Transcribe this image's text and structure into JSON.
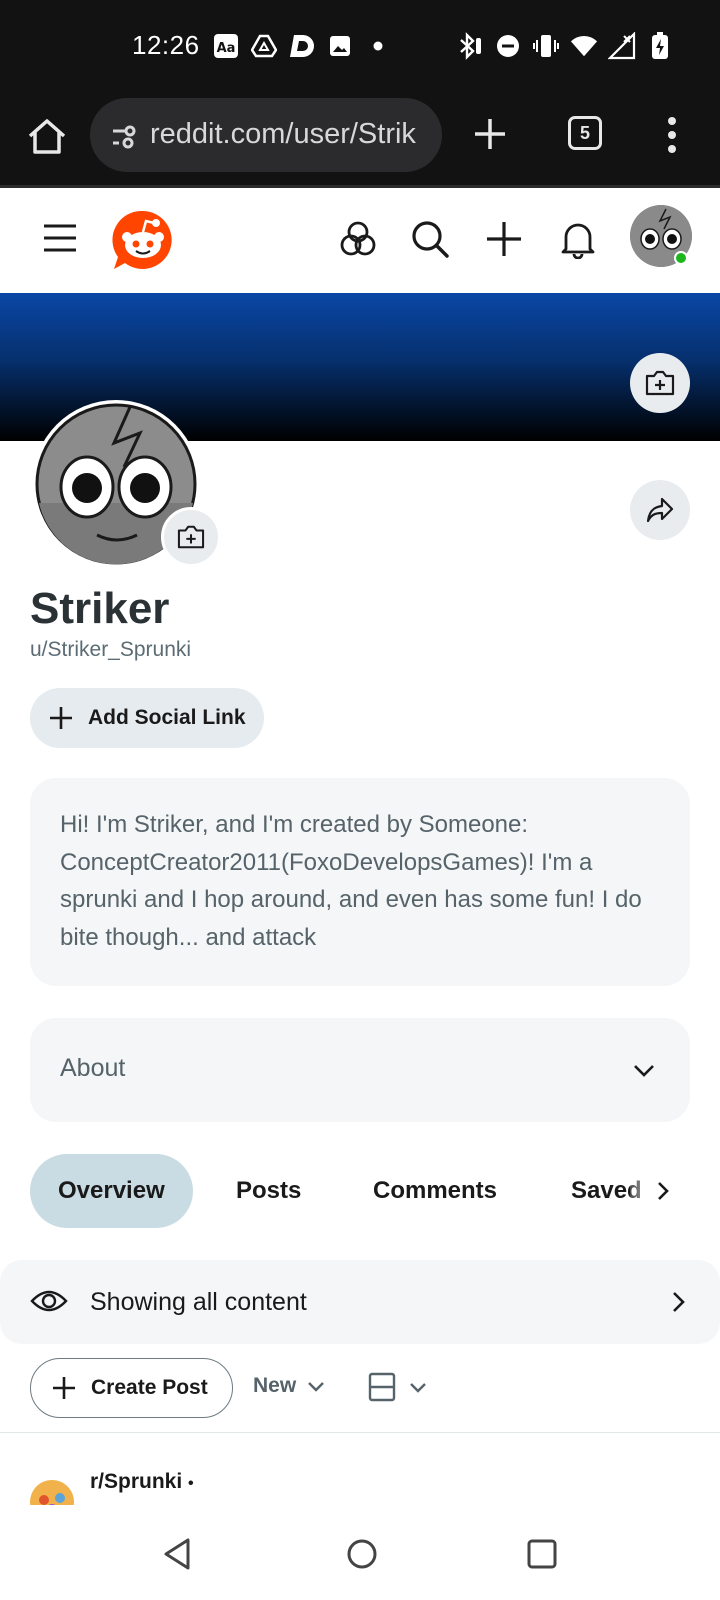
{
  "status_bar": {
    "time": "12:26",
    "left_icons": [
      "translate-icon",
      "drive-icon",
      "d-app-icon",
      "gallery-icon",
      "dot-icon"
    ],
    "right_icons": [
      "bluetooth-icon",
      "dnd-icon",
      "vibrate-icon",
      "wifi-icon",
      "no-signal-icon",
      "battery-charging-icon"
    ]
  },
  "browser": {
    "url": "reddit.com/user/Strik",
    "tab_count": "5"
  },
  "header": {
    "icons": [
      "menu-icon",
      "reddit-logo",
      "popular-icon",
      "search-icon",
      "create-icon",
      "notifications-icon",
      "user-avatar"
    ]
  },
  "profile": {
    "display_name": "Striker",
    "username": "u/Striker_Sprunki",
    "social_link_label": "Add Social Link",
    "bio": "Hi! I'm Striker, and I'm created by Someone: ConceptCreator2011(FoxoDevelopsGames)! I'm a sprunki and I hop around, and even has some fun! I do bite though... and attack",
    "about_label": "About"
  },
  "tabs": [
    {
      "label": "Overview",
      "active": true
    },
    {
      "label": "Posts",
      "active": false
    },
    {
      "label": "Comments",
      "active": false
    },
    {
      "label": "Saved",
      "active": false
    }
  ],
  "filter": {
    "label": "Showing all content"
  },
  "toolbar": {
    "create_post_label": "Create Post",
    "sort_label": "New"
  },
  "post": {
    "subreddit": "r/Sprunki",
    "separator": "•"
  },
  "colors": {
    "reddit_orange": "#ff4500",
    "active_tab_bg": "#c9dbe3",
    "banner_top": "#0a47a6",
    "online": "#1db71d"
  }
}
